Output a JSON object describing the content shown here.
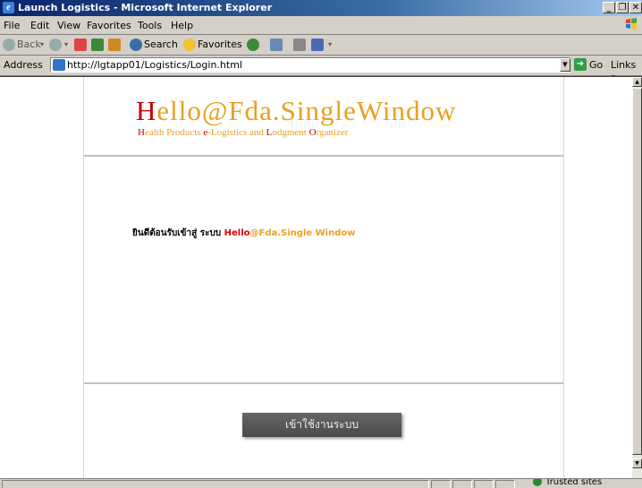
{
  "window": {
    "title": "Launch Logistics - Microsoft Internet Explorer",
    "minimize": "_",
    "restore": "❐",
    "close": "✕"
  },
  "menu": {
    "items": [
      "File",
      "Edit",
      "View",
      "Favorites",
      "Tools",
      "Help"
    ]
  },
  "toolbar": {
    "back": "Back",
    "search": "Search",
    "favorites": "Favorites"
  },
  "address": {
    "label": "Address",
    "url": "http://lgtapp01/Logistics/Login.html",
    "go": "Go",
    "links": "Links »"
  },
  "page": {
    "logo": {
      "h": "H",
      "rest": "ello@Fda.SingleWindow"
    },
    "tagline": {
      "h": "H",
      "t1": "ealth Products ",
      "e": "e",
      "t2": "-Logistics and ",
      "l": "L",
      "t3": "odgment ",
      "o": "O",
      "t4": "rganizer"
    },
    "welcome": {
      "prefix": "ยินดีต้อนรับเข้าสู่ ระบบ ",
      "hello": "Hello",
      "suffix": "@Fda.Single Window"
    },
    "login_button": "เข้าใช้งานระบบ"
  },
  "status": {
    "zone": "Trusted sites"
  },
  "colors": {
    "logo_red": "#c00000",
    "logo_orange": "#e8a020",
    "button_bg": "#555555"
  }
}
